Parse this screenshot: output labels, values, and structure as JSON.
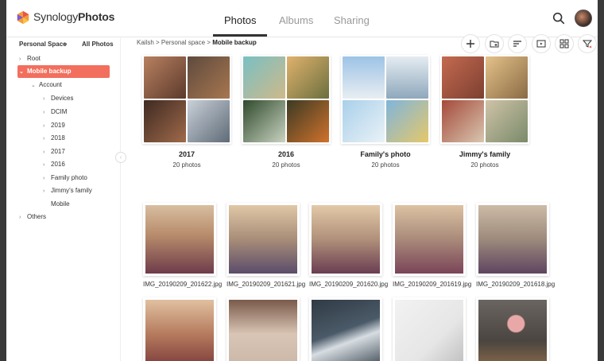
{
  "app": {
    "brand_light": "Synology",
    "brand_bold": "Photos"
  },
  "tabs": [
    {
      "label": "Photos",
      "active": true
    },
    {
      "label": "Albums",
      "active": false
    },
    {
      "label": "Sharing",
      "active": false
    }
  ],
  "header_icons": [
    "search-icon",
    "user-avatar"
  ],
  "sidebar": {
    "space_label": "Personal Space",
    "all_photos": "All Photos",
    "tree": [
      {
        "label": "Root",
        "expanded": false,
        "level": 0
      },
      {
        "label": "Mobile backup",
        "expanded": true,
        "level": 0,
        "selected": true
      },
      {
        "label": "Account",
        "expanded": true,
        "level": 1
      },
      {
        "label": "Devices",
        "expanded": false,
        "level": 2
      },
      {
        "label": "DCIM",
        "expanded": false,
        "level": 2
      },
      {
        "label": "2019",
        "expanded": false,
        "level": 2
      },
      {
        "label": "2018",
        "expanded": false,
        "level": 2
      },
      {
        "label": "2017",
        "expanded": false,
        "level": 2
      },
      {
        "label": "2016",
        "expanded": false,
        "level": 2
      },
      {
        "label": "Family photo",
        "expanded": false,
        "level": 2
      },
      {
        "label": "Jimmy's family",
        "expanded": false,
        "level": 2
      },
      {
        "label": "Mobile",
        "expanded": null,
        "level": 2
      },
      {
        "label": "Others",
        "expanded": false,
        "level": 0
      }
    ]
  },
  "breadcrumb": {
    "p1": "Kailsh",
    "sep": " > ",
    "p2": "Personal space",
    "current": "Mobile backup"
  },
  "toolbar": [
    "add-icon",
    "new-folder-icon",
    "sort-icon",
    "slideshow-icon",
    "grid-view-icon",
    "filter-icon"
  ],
  "albums": [
    {
      "title": "2017",
      "count": "20 photos",
      "colors": [
        "#8a5a3c",
        "#6b4a38",
        "#5d3b2a",
        "#9aa3b0"
      ]
    },
    {
      "title": "2016",
      "count": "20 photos",
      "colors": [
        "#7fb6b9",
        "#c9934e",
        "#4e6a4a",
        "#b9652c"
      ]
    },
    {
      "title": "Family's photo",
      "count": "20 photos",
      "colors": [
        "#a9c4d8",
        "#b7c9d6",
        "#8fb3cc",
        "#c8b25a"
      ]
    },
    {
      "title": "Jimmy's family",
      "count": "20 photos",
      "colors": [
        "#b56b4d",
        "#c59a6a",
        "#9c5a44",
        "#a89a7d"
      ]
    }
  ],
  "photos": [
    {
      "name": "IMG_20190209_201622.jpg",
      "colors": [
        "#c7a07a",
        "#6e3b4a"
      ]
    },
    {
      "name": "IMG_20190209_201621.jpg",
      "colors": [
        "#c9a784",
        "#5b4c6a"
      ]
    },
    {
      "name": "IMG_20190209_201620.jpg",
      "colors": [
        "#d2b08e",
        "#6a3d52"
      ]
    },
    {
      "name": "IMG_20190209_201619.jpg",
      "colors": [
        "#caa585",
        "#7a4458"
      ]
    },
    {
      "name": "IMG_20190209_201618.jpg",
      "colors": [
        "#b9a28a",
        "#5f4560"
      ]
    }
  ],
  "photos_row2": [
    {
      "colors": [
        "#b67b5e",
        "#7b3a3a"
      ]
    },
    {
      "colors": [
        "#c9b6a6",
        "#8a6a5a"
      ]
    },
    {
      "colors": [
        "#4b5a68",
        "#d7dde2"
      ]
    },
    {
      "colors": [
        "#e6e6e6",
        "#9a9a9a"
      ]
    },
    {
      "colors": [
        "#5a5550",
        "#d89a9a"
      ]
    }
  ]
}
